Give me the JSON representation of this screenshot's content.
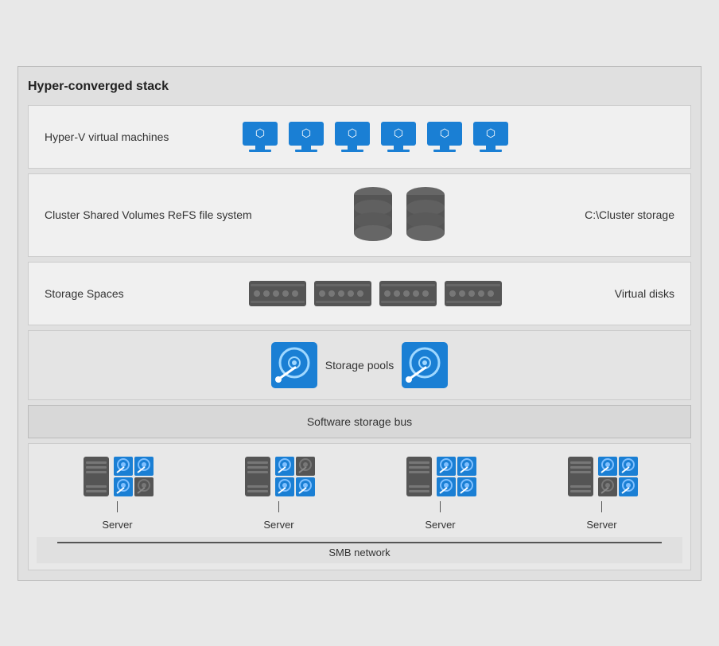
{
  "diagram": {
    "title": "Hyper-converged stack",
    "layers": [
      {
        "id": "hyperv",
        "label": "Hyper-V virtual machines",
        "right_label": "",
        "icon_count": 6,
        "icon_type": "monitor"
      },
      {
        "id": "csv",
        "label": "Cluster Shared Volumes ReFS file system",
        "right_label": "C:\\Cluster storage",
        "icon_count": 2,
        "icon_type": "database"
      },
      {
        "id": "storage_spaces",
        "label": "Storage Spaces",
        "right_label": "Virtual disks",
        "icon_count": 4,
        "icon_type": "disk_rack"
      },
      {
        "id": "storage_pools",
        "label": "Storage pools",
        "right_label": "",
        "icon_count": 2,
        "icon_type": "hdd_blue"
      },
      {
        "id": "software_bus",
        "label": "Software storage bus",
        "icon_type": "bus"
      }
    ],
    "servers": [
      "Server",
      "Server",
      "Server",
      "Server"
    ],
    "smb_label": "SMB network"
  }
}
